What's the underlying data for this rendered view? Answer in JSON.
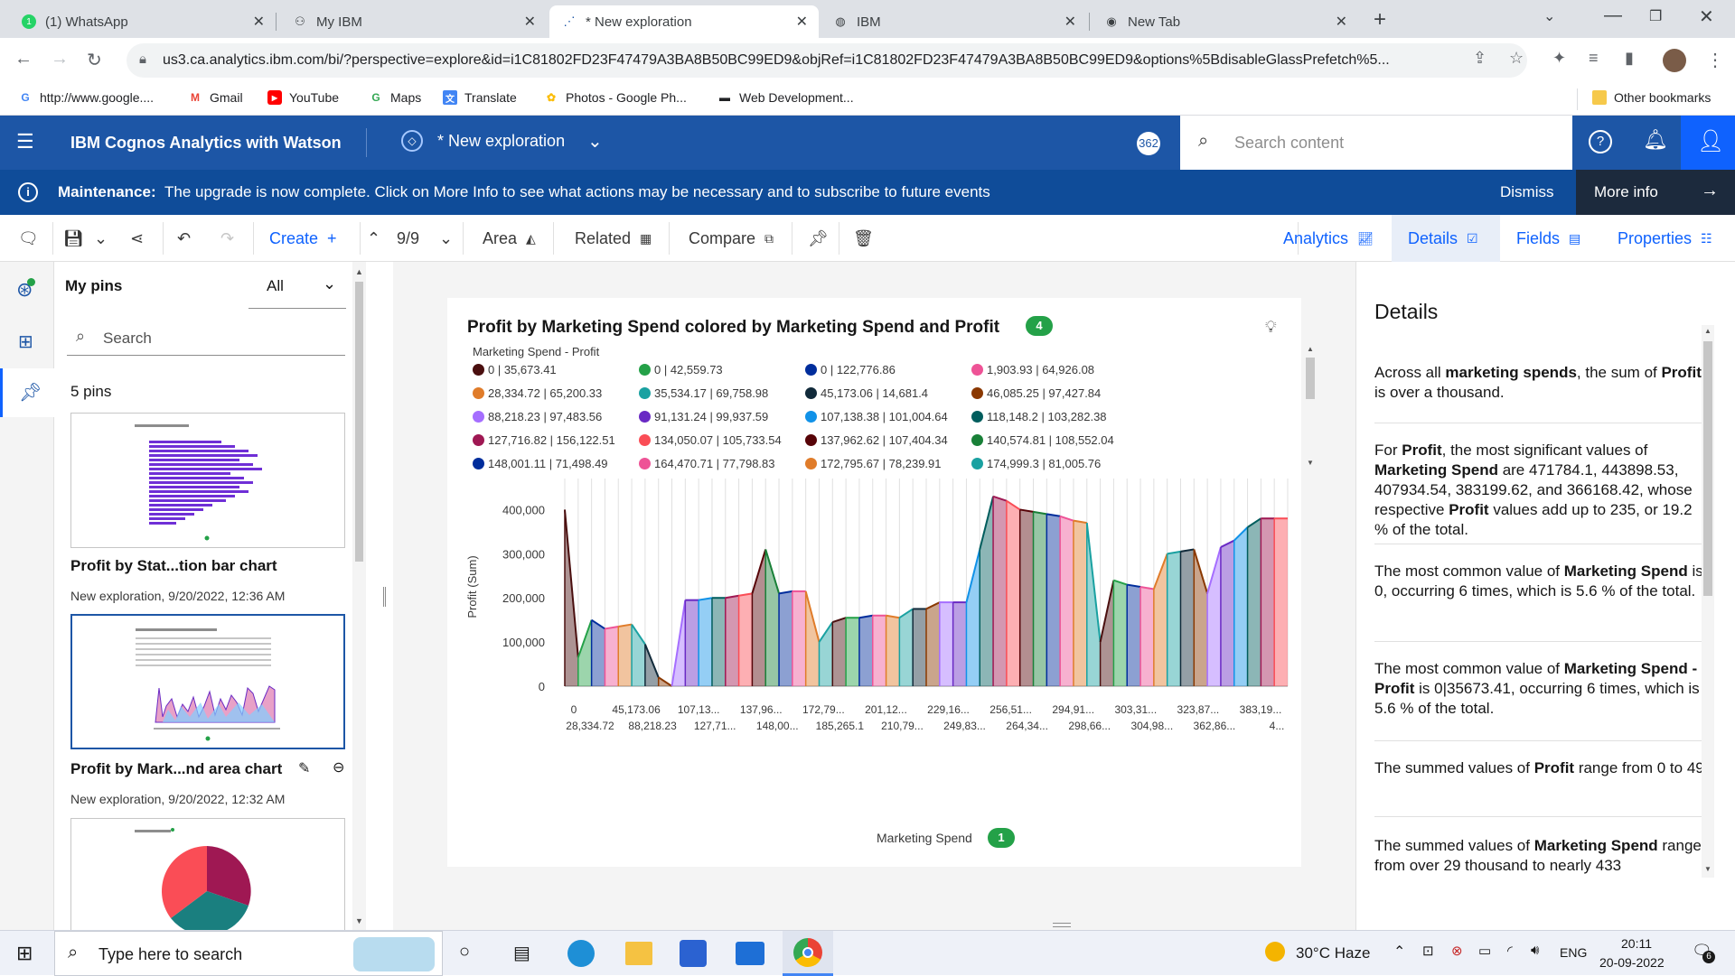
{
  "browser": {
    "tabs": [
      {
        "title": "(1) WhatsApp",
        "icon": "whatsapp-icon"
      },
      {
        "title": "My IBM",
        "icon": "ibm-icon"
      },
      {
        "title": "* New exploration",
        "icon": "exploration-icon"
      },
      {
        "title": "IBM",
        "icon": "globe-icon"
      },
      {
        "title": "New Tab",
        "icon": "chrome-icon"
      }
    ],
    "url": "us3.ca.analytics.ibm.com/bi/?perspective=explore&id=i1C81802FD23F47479A3BA8B50BC99ED9&objRef=i1C81802FD23F47479A3BA8B50BC99ED9&options%5BdisableGlassPrefetch%5...",
    "bookmarks": [
      "http://www.google....",
      "Gmail",
      "YouTube",
      "Maps",
      "Translate",
      "Photos - Google Ph...",
      "Web Development...",
      "Other bookmarks"
    ]
  },
  "app": {
    "product": "IBM Cognos Analytics with Watson",
    "exploration_title": "* New exploration",
    "badge": "362",
    "search_placeholder": "Search content"
  },
  "maintenance": {
    "label": "Maintenance:",
    "message": "The upgrade is now complete. Click on More Info to see what actions may be necessary and to subscribe to future events",
    "dismiss": "Dismiss",
    "more_info": "More info"
  },
  "toolbar": {
    "create": "Create",
    "counter": "9/9",
    "area": "Area",
    "related": "Related",
    "compare": "Compare",
    "analytics": "Analytics",
    "details": "Details",
    "fields": "Fields",
    "properties": "Properties"
  },
  "pins": {
    "title": "My pins",
    "filter": "All",
    "search_placeholder": "Search",
    "count": "5 pins",
    "items": [
      {
        "title": "Profit by Stat...tion bar chart",
        "meta": "New exploration, 9/20/2022, 12:36 AM"
      },
      {
        "title": "Profit by Mark...nd area chart",
        "meta": "New exploration, 9/20/2022, 12:32 AM"
      }
    ]
  },
  "chart": {
    "title": "Profit by Marketing Spend colored by Marketing Spend and Profit",
    "title_badge": "4",
    "legend_title": "Marketing Spend - Profit",
    "legend": [
      {
        "label": "0 | 35,673.41",
        "color": "#4a0f0f"
      },
      {
        "label": "0 | 42,559.73",
        "color": "#24a148"
      },
      {
        "label": "0 | 122,776.86",
        "color": "#002d9c"
      },
      {
        "label": "1,903.93 | 64,926.08",
        "color": "#ee5396"
      },
      {
        "label": "28,334.72 | 65,200.33",
        "color": "#e07c2a"
      },
      {
        "label": "35,534.17 | 69,758.98",
        "color": "#1aa1a1"
      },
      {
        "label": "45,173.06 | 14,681.4",
        "color": "#112a3a"
      },
      {
        "label": "46,085.25 | 97,427.84",
        "color": "#8a3800"
      },
      {
        "label": "88,218.23 | 97,483.56",
        "color": "#a56eff"
      },
      {
        "label": "91,131.24 | 99,937.59",
        "color": "#6929c4"
      },
      {
        "label": "107,138.38 | 101,004.64",
        "color": "#1192e8"
      },
      {
        "label": "118,148.2 | 103,282.38",
        "color": "#005d5d"
      },
      {
        "label": "127,716.82 | 156,122.51",
        "color": "#9f1853"
      },
      {
        "label": "134,050.07 | 105,733.54",
        "color": "#fa4d56"
      },
      {
        "label": "137,962.62 | 107,404.34",
        "color": "#570408"
      },
      {
        "label": "140,574.81 | 108,552.04",
        "color": "#198038"
      },
      {
        "label": "148,001.11 | 71,498.49",
        "color": "#002d9c"
      },
      {
        "label": "164,470.71 | 77,798.83",
        "color": "#ee5396"
      },
      {
        "label": "172,795.67 | 78,239.91",
        "color": "#e07c2a"
      },
      {
        "label": "174,999.3 | 81,005.76",
        "color": "#1aa1a1"
      }
    ],
    "ylabel": "Profit (Sum)",
    "xlabel": "Marketing Spend",
    "xlabel_badge": "1",
    "yticks": [
      "0",
      "100,000",
      "200,000",
      "300,000",
      "400,000"
    ],
    "xticks_top": [
      "0",
      "45,173.06",
      "107,13...",
      "137,96...",
      "172,79...",
      "201,12...",
      "229,16...",
      "256,51...",
      "294,91...",
      "303,31...",
      "323,87...",
      "383,19..."
    ],
    "xticks_bottom": [
      "28,334.72",
      "88,218.23",
      "127,71...",
      "148,00...",
      "185,265.1",
      "210,79...",
      "249,83...",
      "264,34...",
      "298,66...",
      "304,98...",
      "362,86...",
      "4..."
    ]
  },
  "chart_data": {
    "type": "area",
    "xlabel": "Marketing Spend",
    "ylabel": "Profit (Sum)",
    "ylim": [
      0,
      450000
    ],
    "values": [
      400000,
      65000,
      150000,
      130000,
      135000,
      140000,
      95000,
      20000,
      0,
      195000,
      195000,
      200000,
      200000,
      205000,
      210000,
      310000,
      210000,
      215000,
      215000,
      100000,
      145000,
      155000,
      155000,
      160000,
      160000,
      155000,
      175000,
      175000,
      190000,
      190000,
      190000,
      310000,
      430000,
      420000,
      400000,
      395000,
      390000,
      385000,
      375000,
      370000,
      100000,
      240000,
      230000,
      225000,
      220000,
      300000,
      305000,
      310000,
      210000,
      315000,
      330000,
      360000,
      380000,
      380000,
      380000
    ]
  },
  "details": {
    "title": "Details",
    "insights": [
      "Across all marketing spends, the sum of Profit is over a thousand.",
      "For Profit, the most significant values of Marketing Spend are 471784.1, 443898.53, 407934.54, 383199.62, and 366168.42, whose respective Profit values add up to 235, or 19.2 % of the total.",
      "The most common value of Marketing Spend is 0, occurring 6 times, which is 5.6 % of the total.",
      "The most common value of Marketing Spend - Profit is 0|35673.41, occurring 6 times, which is 5.6 % of the total.",
      "The summed values of Profit range from 0 to 49.",
      "The summed values of Marketing Spend range from over 29 thousand to nearly 433"
    ]
  },
  "taskbar": {
    "search_placeholder": "Type here to search",
    "weather": "30°C  Haze",
    "lang": "ENG",
    "time": "20:11",
    "date": "20-09-2022",
    "notifications": "6"
  }
}
